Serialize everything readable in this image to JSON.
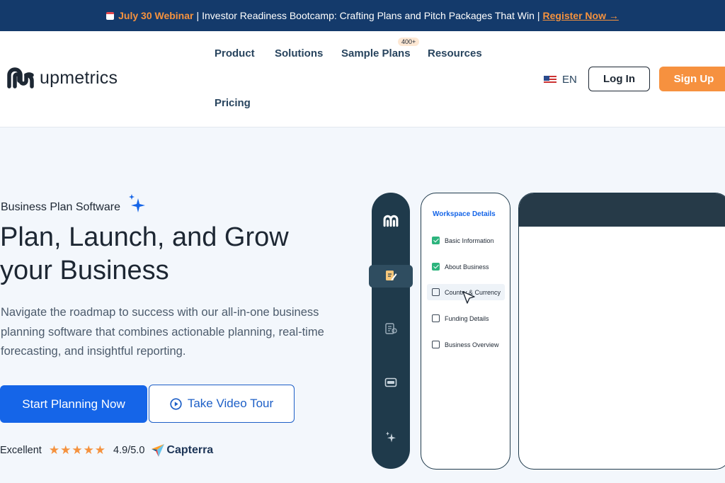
{
  "announcement": {
    "date": "July 30 Webinar",
    "separator": "|",
    "text": "Investor Readiness Bootcamp: Crafting Plans and Pitch Packages That Win",
    "separator2": "|",
    "cta": "Register Now →"
  },
  "header": {
    "logo_text": "upmetrics",
    "nav": [
      "Product",
      "Solutions",
      "Sample Plans",
      "Resources",
      "Pricing"
    ],
    "sample_plans_badge": "400+",
    "language": "EN",
    "login_label": "Log In",
    "signup_label": "Sign Up"
  },
  "hero": {
    "eyebrow": "Business Plan Software",
    "title": "Plan, Launch, and Grow your Business",
    "lead": "Navigate the roadmap to success with our all-in-one business planning software that combines actionable planning, real-time forecasting, and insightful reporting.",
    "primary_cta": "Start Planning Now",
    "secondary_cta": "Take Video Tour",
    "rating_label": "Excellent",
    "stars": "★★★★★",
    "rating_value": "4.9/5.0",
    "review_site": "Capterra"
  },
  "mockup": {
    "panel_title": "Workspace Details",
    "steps": [
      {
        "label": "Basic Information",
        "checked": true
      },
      {
        "label": "About Business",
        "checked": true
      },
      {
        "label": "Country & Currency",
        "checked": false
      },
      {
        "label": "Funding Details",
        "checked": false
      },
      {
        "label": "Business Overview",
        "checked": false
      }
    ]
  },
  "colors": {
    "announce_bg": "#143a6b",
    "accent_orange": "#f6913f",
    "primary_blue": "#1565e8",
    "rail_dark": "#1f3a4b",
    "check_green": "#2db47d"
  }
}
